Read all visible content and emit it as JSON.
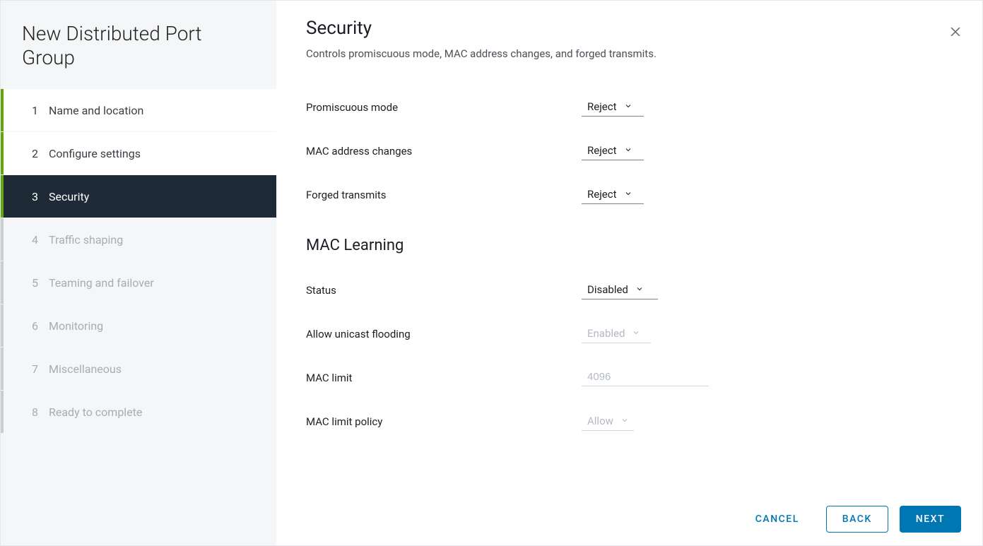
{
  "title": "New Distributed Port Group",
  "steps": [
    {
      "num": "1",
      "label": "Name and location",
      "state": "completed"
    },
    {
      "num": "2",
      "label": "Configure settings",
      "state": "completed"
    },
    {
      "num": "3",
      "label": "Security",
      "state": "current"
    },
    {
      "num": "4",
      "label": "Traffic shaping",
      "state": "future"
    },
    {
      "num": "5",
      "label": "Teaming and failover",
      "state": "future"
    },
    {
      "num": "6",
      "label": "Monitoring",
      "state": "future"
    },
    {
      "num": "7",
      "label": "Miscellaneous",
      "state": "future"
    },
    {
      "num": "8",
      "label": "Ready to complete",
      "state": "future"
    }
  ],
  "panel": {
    "title": "Security",
    "description": "Controls promiscuous mode, MAC address changes, and forged transmits.",
    "section2_title": "MAC Learning",
    "rows": {
      "promiscuous": {
        "label": "Promiscuous mode",
        "value": "Reject"
      },
      "mac_changes": {
        "label": "MAC address changes",
        "value": "Reject"
      },
      "forged": {
        "label": "Forged transmits",
        "value": "Reject"
      },
      "status": {
        "label": "Status",
        "value": "Disabled"
      },
      "unicast": {
        "label": "Allow unicast flooding",
        "value": "Enabled"
      },
      "mac_limit": {
        "label": "MAC limit",
        "value": "4096"
      },
      "mac_policy": {
        "label": "MAC limit policy",
        "value": "Allow"
      }
    }
  },
  "footer": {
    "cancel": "CANCEL",
    "back": "BACK",
    "next": "NEXT"
  }
}
